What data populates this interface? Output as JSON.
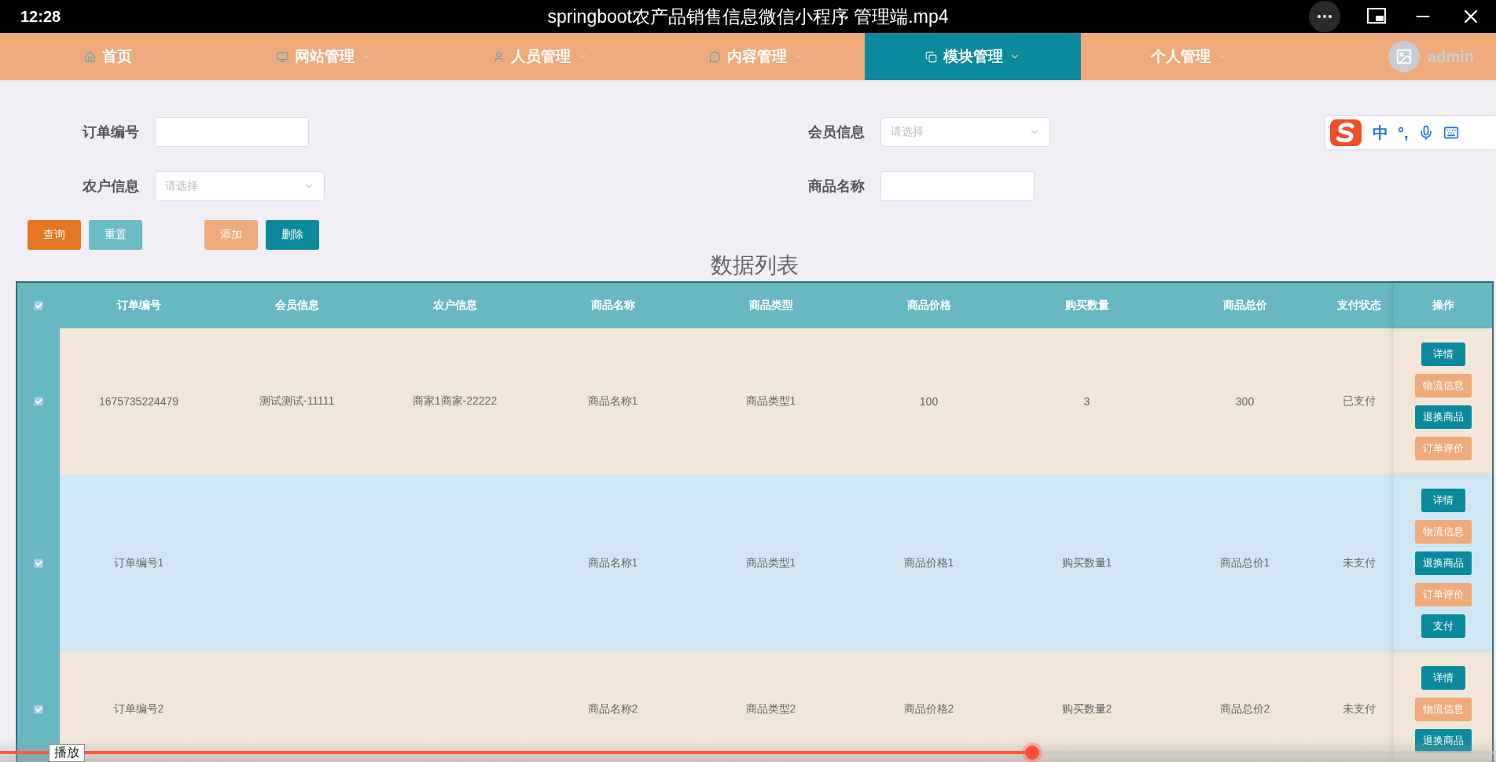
{
  "player": {
    "time": "12:28",
    "title": "springboot农产品销售信息微信小程序 管理端.mp4",
    "progress": {
      "level": 0.69
    },
    "tooltip": "播放"
  },
  "nav": {
    "items": [
      {
        "label": "首页",
        "has_menu": false,
        "selected": false
      },
      {
        "label": "网站管理",
        "has_menu": true,
        "selected": false
      },
      {
        "label": "人员管理",
        "has_menu": true,
        "selected": false
      },
      {
        "label": "内容管理",
        "has_menu": true,
        "selected": false
      },
      {
        "label": "模块管理",
        "has_menu": true,
        "selected": true
      },
      {
        "label": "个人管理",
        "has_menu": true,
        "selected": false
      }
    ],
    "user": "admin"
  },
  "ime": {
    "mode": "中",
    "punct": "°,"
  },
  "filters": [
    {
      "label": "订单编号",
      "kind": "input"
    },
    {
      "label": "会员信息",
      "kind": "select",
      "placeholder": "请选择"
    },
    {
      "label": "农户信息",
      "kind": "select",
      "placeholder": "请选择"
    },
    {
      "label": "商品名称",
      "kind": "input"
    }
  ],
  "buttons": [
    {
      "label": "查询",
      "kind": "search"
    },
    {
      "label": "重置",
      "kind": "reset"
    },
    {
      "label": "添加",
      "kind": "add"
    },
    {
      "label": "删除",
      "kind": "delete"
    }
  ],
  "table": {
    "title": "数据列表",
    "select_all": {
      "checked": true
    },
    "columns": [
      "订单编号",
      "会员信息",
      "农户信息",
      "商品名称",
      "商品类型",
      "商品价格",
      "购买数量",
      "商品总价",
      "支付状态",
      "操作"
    ],
    "rows": [
      {
        "checked": true,
        "order_no": "1675735224479",
        "member": "测试测试-11111",
        "farmer": "商家1商家-22222",
        "name": "商品名称1",
        "type": "商品类型1",
        "price": "100",
        "qty": "3",
        "total": "300",
        "status": "已支付",
        "actions": [
          {
            "label": "详情",
            "kind": "primary"
          },
          {
            "label": "物流信息",
            "kind": "warm"
          },
          {
            "label": "退换商品",
            "kind": "primary"
          },
          {
            "label": "订单评价",
            "kind": "warm"
          }
        ]
      },
      {
        "checked": true,
        "order_no": "订单编号1",
        "name": "商品名称1",
        "type": "商品类型1",
        "price": "商品价格1",
        "qty": "购买数量1",
        "total": "商品总价1",
        "status": "未支付",
        "actions": [
          {
            "label": "详情",
            "kind": "primary"
          },
          {
            "label": "物流信息",
            "kind": "warm"
          },
          {
            "label": "退换商品",
            "kind": "primary"
          },
          {
            "label": "订单评价",
            "kind": "warm"
          },
          {
            "label": "支付",
            "kind": "primary"
          }
        ]
      },
      {
        "checked": true,
        "order_no": "订单编号2",
        "name": "商品名称2",
        "type": "商品类型2",
        "price": "商品价格2",
        "qty": "购买数量2",
        "total": "商品总价2",
        "status": "未支付",
        "actions": [
          {
            "label": "详情",
            "kind": "primary"
          },
          {
            "label": "物流信息",
            "kind": "warm"
          },
          {
            "label": "退换商品",
            "kind": "primary"
          }
        ]
      }
    ]
  }
}
